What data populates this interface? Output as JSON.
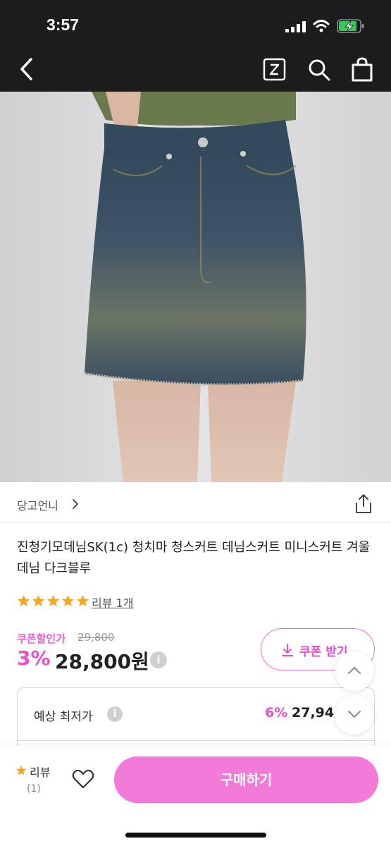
{
  "status_bar": {
    "time": "3:57"
  },
  "nav": {
    "back": "back",
    "z_icon": "Z",
    "search": "search",
    "bag": "bag"
  },
  "shop": {
    "name": "당고언니"
  },
  "product": {
    "title": "진청기모데님SK(1c) 청치마 청스커트 데님스커트 미니스커트 겨울데님 다크블루",
    "rating_stars": 5,
    "review_link": "리뷰 1개"
  },
  "price": {
    "coupon_label": "쿠폰할인가",
    "original": "29,800",
    "discount": "3%",
    "current": "28,800원",
    "info_icon": "i"
  },
  "coupon_button": {
    "label": "쿠폰 받기"
  },
  "estimate": {
    "label": "예상 최저가",
    "info_icon": "i",
    "percent": "6%",
    "price": "27,940"
  },
  "bottom": {
    "review_label": "리뷰",
    "review_count": "(1)",
    "buy_label": "구매하기"
  },
  "colors": {
    "accent": "#ec4fcd",
    "buy_button": "#f27ad9",
    "star": "#f5a623",
    "topbar": "#1c1c1e"
  }
}
